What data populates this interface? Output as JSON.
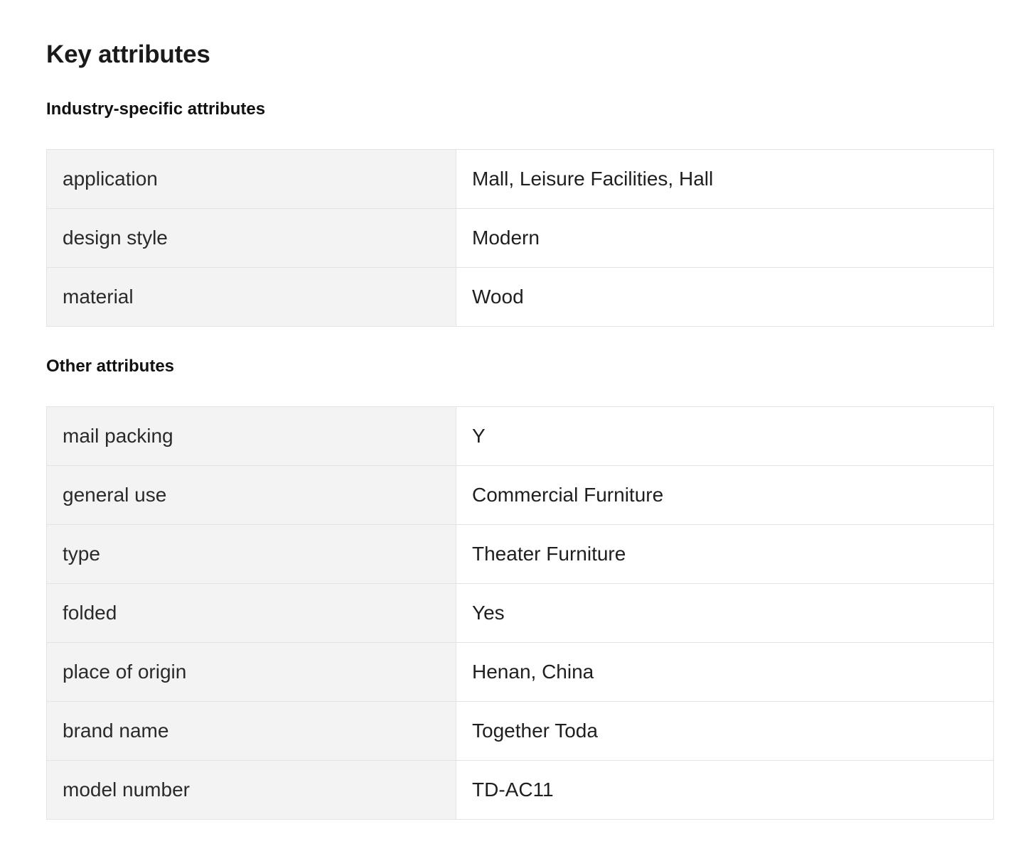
{
  "heading": "Key attributes",
  "sections": [
    {
      "title": "Industry-specific attributes",
      "rows": [
        {
          "key": "application",
          "value": "Mall, Leisure Facilities, Hall"
        },
        {
          "key": "design style",
          "value": "Modern"
        },
        {
          "key": "material",
          "value": "Wood"
        }
      ]
    },
    {
      "title": "Other attributes",
      "rows": [
        {
          "key": "mail packing",
          "value": "Y"
        },
        {
          "key": "general use",
          "value": "Commercial Furniture"
        },
        {
          "key": "type",
          "value": "Theater Furniture"
        },
        {
          "key": "folded",
          "value": "Yes"
        },
        {
          "key": "place of origin",
          "value": "Henan, China"
        },
        {
          "key": "brand name",
          "value": "Together Toda"
        },
        {
          "key": "model number",
          "value": "TD-AC11"
        }
      ]
    }
  ],
  "colors": {
    "key_cell_background": "#f3f3f3",
    "value_cell_background": "#ffffff",
    "border": "#e3e3e3",
    "text": "#222222"
  }
}
